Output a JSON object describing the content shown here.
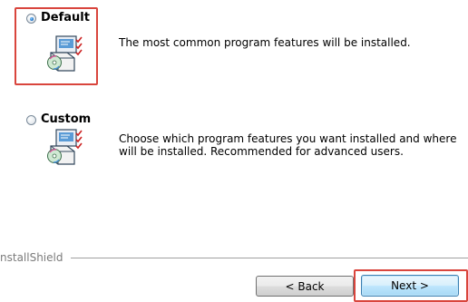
{
  "options": {
    "default": {
      "label": "Default",
      "description": "The most common program features will be installed.",
      "selected": true
    },
    "custom": {
      "label": "Custom",
      "description_line1": "Choose which program features you want installed and where",
      "description_line2": "will be installed. Recommended for advanced users.",
      "selected": false
    }
  },
  "footer": {
    "brand": "nstallShield",
    "back_label": "< Back",
    "next_label": "Next >"
  },
  "colors": {
    "highlight": "#d9453d",
    "radio_selected": "#1d6fc4",
    "divider": "#a0a0a0",
    "brand_text": "#7b7b7b"
  },
  "icons": {
    "setup": "setup-package-icon",
    "radio": "radio-button"
  }
}
